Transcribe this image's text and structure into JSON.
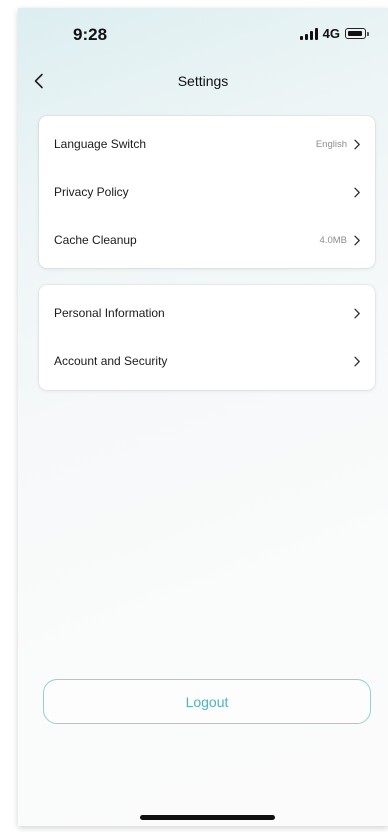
{
  "status_bar": {
    "time": "9:28",
    "network": "4G"
  },
  "header": {
    "title": "Settings",
    "back_icon": "chevron-left-icon"
  },
  "groups": [
    {
      "items": [
        {
          "label": "Language Switch",
          "value": "English"
        },
        {
          "label": "Privacy Policy",
          "value": ""
        },
        {
          "label": "Cache Cleanup",
          "value": "4.0MB"
        }
      ]
    },
    {
      "items": [
        {
          "label": "Personal Information",
          "value": ""
        },
        {
          "label": "Account and Security",
          "value": ""
        }
      ]
    }
  ],
  "logout": {
    "label": "Logout"
  },
  "colors": {
    "accent": "#4eb5b9",
    "accent_border": "#8fd3d6",
    "background_tint": "#dceef0"
  }
}
